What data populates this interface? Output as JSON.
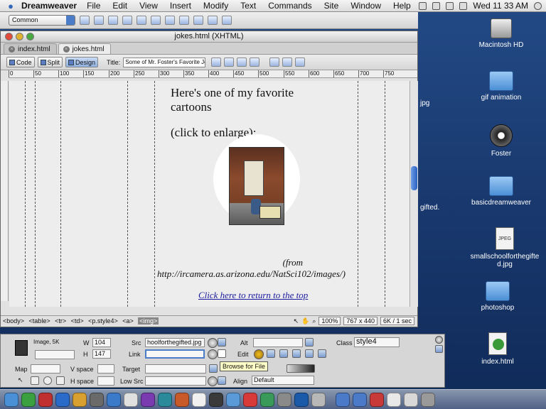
{
  "menubar": {
    "app": "Dreamweaver",
    "items": [
      "File",
      "Edit",
      "View",
      "Insert",
      "Modify",
      "Text",
      "Commands",
      "Site",
      "Window",
      "Help"
    ],
    "clock": "Wed 11 33 AM"
  },
  "insertbar": {
    "category": "Common"
  },
  "document": {
    "window_title": "jokes.html (XHTML)",
    "tabs": [
      {
        "label": "index.html"
      },
      {
        "label": "jokes.html"
      }
    ],
    "views": {
      "code": "Code",
      "split": "Split",
      "design": "Design"
    },
    "title_label": "Title:",
    "title_value": "Some of Mr. Foster's Favorite Jo",
    "ruler_ticks": [
      "0",
      "50",
      "100",
      "150",
      "200",
      "250",
      "300",
      "350",
      "400",
      "450",
      "500",
      "550",
      "600",
      "650",
      "700",
      "750"
    ],
    "content": {
      "line1": "Here's one of my favorite",
      "line2": "cartoons",
      "line3": "(click to enlarge):",
      "caption1": "(from",
      "caption2": "http://ircamera.as.arizona.edu/NatSci102/images/)",
      "link": "Click here to return to the top"
    },
    "status": {
      "tags": [
        "<body>",
        "<table>",
        "<tr>",
        "<td>",
        "<p.style4>",
        "<a>",
        "<img>"
      ],
      "zoom": "100%",
      "size": "767 x 440",
      "download": "6K / 1 sec"
    }
  },
  "properties": {
    "element_type": "Image, 5K",
    "w_label": "W",
    "w_value": "104",
    "h_label": "H",
    "h_value": "147",
    "src_label": "Src",
    "src_value": "hoolforthegifted.jpg",
    "link_label": "Link",
    "link_value": "",
    "alt_label": "Alt",
    "edit_label": "Edit",
    "class_label": "Class",
    "class_value": "style4",
    "map_label": "Map",
    "vspace_label": "V space",
    "target_label": "Target",
    "hspace_label": "H space",
    "lowsrc_label": "Low Src",
    "align_label": "Align",
    "align_value": "Default",
    "tooltip": "Browse for File"
  },
  "desktop": {
    "icons": [
      {
        "label": "Macintosh HD"
      },
      {
        "label": "gif animation"
      },
      {
        "label": "Foster"
      },
      {
        "label": "basicdreamweaver"
      },
      {
        "label": "smallschoolforthegifted.jpg"
      },
      {
        "label": "photoshop"
      },
      {
        "label": "index.html"
      }
    ],
    "partial": [
      "jpg",
      "gifted."
    ]
  },
  "colors": {
    "accent": "#3a6fcf",
    "link": "#1a1aa0",
    "tooltip": "#ffffc8"
  }
}
